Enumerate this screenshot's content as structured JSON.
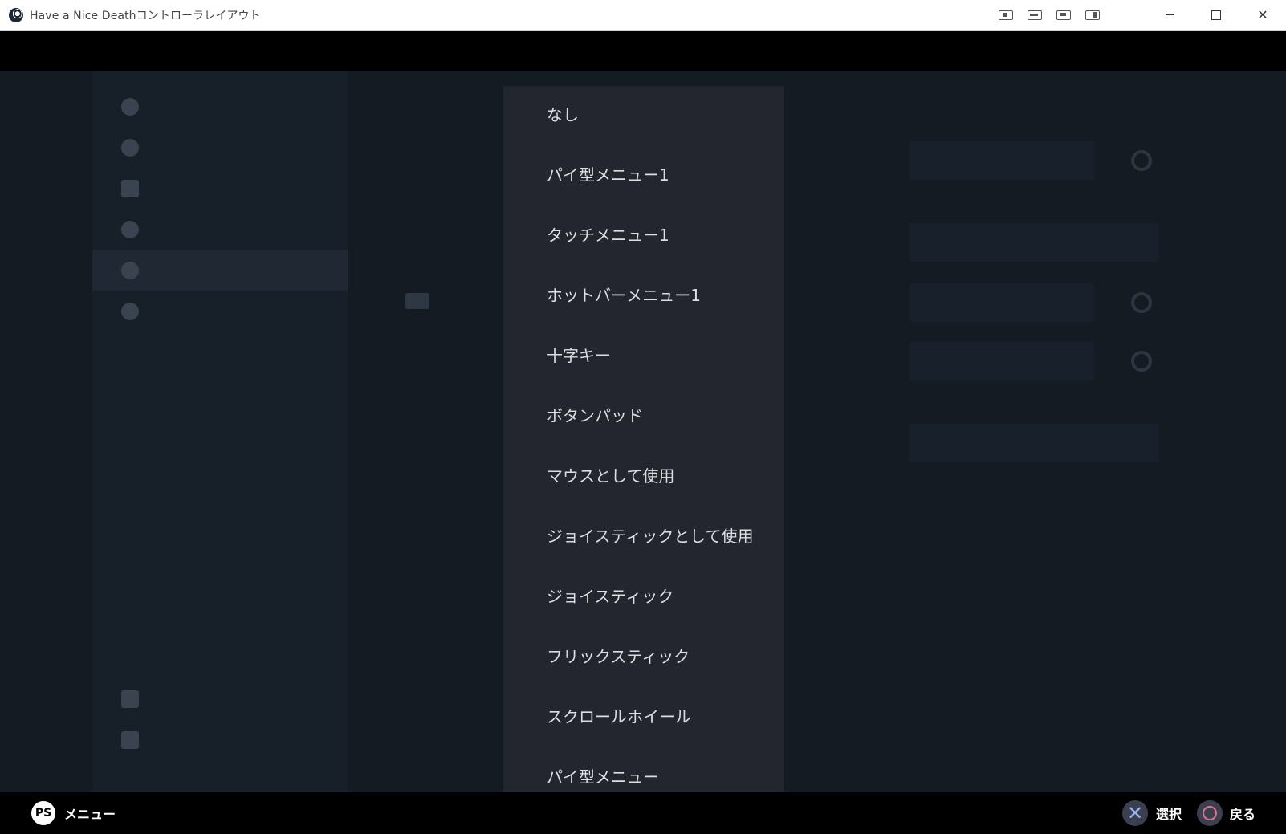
{
  "window": {
    "title": "Have a Nice Deathコントローラレイアウト",
    "icons": [
      "screenshot-icon",
      "layout-icon",
      "view-icon",
      "panel-icon"
    ],
    "controls": [
      "minimize-icon",
      "maximize-icon",
      "close-icon"
    ],
    "close_glyph": "✕"
  },
  "dropdown": {
    "options": [
      "なし",
      "パイ型メニュー1",
      "タッチメニュー1",
      "ホットバーメニュー1",
      "十字キー",
      "ボタンパッド",
      "マウスとして使用",
      "ジョイスティックとして使用",
      "ジョイスティック",
      "フリックスティック",
      "スクロールホイール",
      "パイ型メニュー"
    ]
  },
  "footer": {
    "menu_label": "メニュー",
    "select_label": "選択",
    "back_label": "戻る",
    "accent_cross": "#9fb4ee",
    "accent_circle": "#e0738c"
  },
  "colors": {
    "background": "#141b23",
    "dropdown_bg": "#23262f",
    "dropdown_text": "#dcdedf"
  }
}
